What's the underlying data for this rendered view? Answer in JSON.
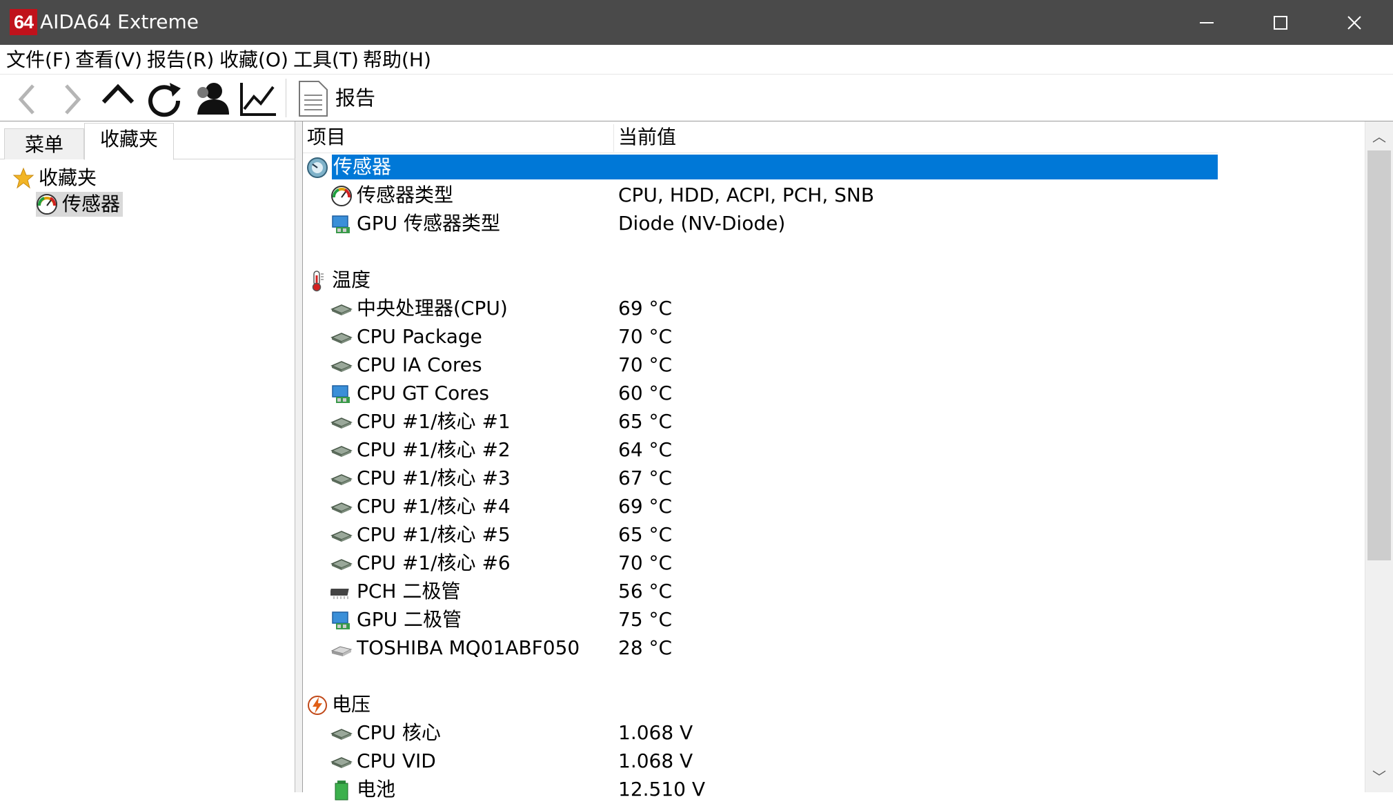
{
  "window": {
    "logo": "64",
    "title": "AIDA64 Extreme"
  },
  "menubar": [
    "文件(F)",
    "查看(V)",
    "报告(R)",
    "收藏(O)",
    "工具(T)",
    "帮助(H)"
  ],
  "toolbar": {
    "buttons": [
      "back-icon",
      "forward-icon",
      "up-icon",
      "refresh-icon",
      "user-icon",
      "chart-icon"
    ],
    "report_label": "报告"
  },
  "left": {
    "tabs": [
      "菜单",
      "收藏夹"
    ],
    "tree": {
      "root": "收藏夹",
      "child": "传感器"
    }
  },
  "table": {
    "col_item": "项目",
    "col_value": "当前值",
    "rows": [
      {
        "type": "group",
        "icon": "sensor-icon",
        "label": "传感器",
        "value": "",
        "selected": true
      },
      {
        "type": "item",
        "icon": "gauge-icon",
        "label": "传感器类型",
        "value": "CPU, HDD, ACPI, PCH, SNB"
      },
      {
        "type": "item",
        "icon": "gpu-icon",
        "label": "GPU 传感器类型",
        "value": "Diode  (NV-Diode)"
      },
      {
        "type": "blank"
      },
      {
        "type": "group",
        "icon": "thermometer-icon",
        "label": "温度",
        "value": ""
      },
      {
        "type": "item",
        "icon": "cpu-chip-icon",
        "label": "中央处理器(CPU)",
        "value": "69 °C"
      },
      {
        "type": "item",
        "icon": "cpu-chip-icon",
        "label": "CPU Package",
        "value": "70 °C"
      },
      {
        "type": "item",
        "icon": "cpu-chip-icon",
        "label": "CPU IA Cores",
        "value": "70 °C"
      },
      {
        "type": "item",
        "icon": "gpu-icon",
        "label": "CPU GT Cores",
        "value": "60 °C"
      },
      {
        "type": "item",
        "icon": "cpu-chip-icon",
        "label": "CPU #1/核心 #1",
        "value": "65 °C"
      },
      {
        "type": "item",
        "icon": "cpu-chip-icon",
        "label": "CPU #1/核心 #2",
        "value": "64 °C"
      },
      {
        "type": "item",
        "icon": "cpu-chip-icon",
        "label": "CPU #1/核心 #3",
        "value": "67 °C"
      },
      {
        "type": "item",
        "icon": "cpu-chip-icon",
        "label": "CPU #1/核心 #4",
        "value": "69 °C"
      },
      {
        "type": "item",
        "icon": "cpu-chip-icon",
        "label": "CPU #1/核心 #5",
        "value": "65 °C"
      },
      {
        "type": "item",
        "icon": "cpu-chip-icon",
        "label": "CPU #1/核心 #6",
        "value": "70 °C"
      },
      {
        "type": "item",
        "icon": "chipset-icon",
        "label": "PCH 二极管",
        "value": "56 °C"
      },
      {
        "type": "item",
        "icon": "gpu-icon",
        "label": "GPU 二极管",
        "value": "75 °C"
      },
      {
        "type": "item",
        "icon": "hdd-icon",
        "label": "TOSHIBA MQ01ABF050",
        "value": "28 °C"
      },
      {
        "type": "blank"
      },
      {
        "type": "group",
        "icon": "voltage-icon",
        "label": "电压",
        "value": ""
      },
      {
        "type": "item",
        "icon": "cpu-chip-icon",
        "label": "CPU 核心",
        "value": "1.068 V"
      },
      {
        "type": "item",
        "icon": "cpu-chip-icon",
        "label": "CPU VID",
        "value": "1.068 V"
      },
      {
        "type": "item",
        "icon": "battery-icon",
        "label": "电池",
        "value": "12.510 V"
      }
    ]
  },
  "colors": {
    "titlebar": "#4a4a4a",
    "selection": "#0078d7",
    "logo": "#c0121b"
  }
}
